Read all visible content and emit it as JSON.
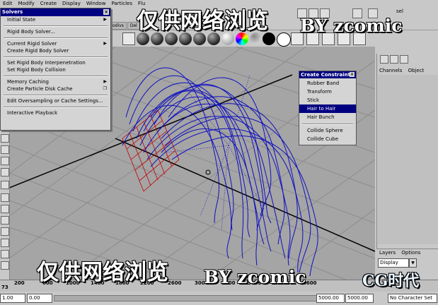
{
  "menubar": {
    "items": [
      "Edit",
      "Modify",
      "Create",
      "Display",
      "Window",
      "Particles",
      "Flu"
    ]
  },
  "toolbar": {
    "sel_label": "sel"
  },
  "shelf_tabs": [
    "odivs",
    "Del"
  ],
  "solvers_menu": {
    "title": "Solvers",
    "items": [
      {
        "label": "Initial State",
        "arrow": "▶"
      },
      {
        "label": "Rigid Body Solver..."
      },
      {
        "label": "Current Rigid Solver",
        "arrow": "▶"
      },
      {
        "label": "Create Rigid Body Solver"
      },
      {
        "label": "Set Rigid Body Interpenetration"
      },
      {
        "label": "Set Rigid Body Collision"
      },
      {
        "label": "Memory Caching",
        "arrow": "▶"
      },
      {
        "label": "Create Particle Disk Cache",
        "arrow": "❐"
      },
      {
        "label": "Edit Oversampling or Cache Settings..."
      },
      {
        "label": "Interactive Playback"
      }
    ]
  },
  "constraint_menu": {
    "title": "Create Constraint",
    "items": [
      "Rubber Band",
      "Transform",
      "Stick",
      "Hair to Hair",
      "Hair Bunch",
      "Collide Sphere",
      "Collide Cube"
    ],
    "selected": "Hair to Hair"
  },
  "channel_box": {
    "tabs": [
      "Channels",
      "Object"
    ]
  },
  "layers": {
    "tabs": [
      "Layers",
      "Options"
    ],
    "display": "Display"
  },
  "timeline": {
    "ticks": [
      "200",
      "600",
      "1000",
      "1400",
      "1800",
      "2200",
      "2600",
      "3000",
      "3400",
      "3800",
      "4200",
      "4600"
    ],
    "current_frame": "73"
  },
  "range": {
    "start": "1.00",
    "field2": "0.00",
    "end1": "5000.00",
    "end2": "5000.00",
    "character_set": "No Character Set"
  },
  "watermarks": {
    "top": "仅供网络浏览",
    "top_by": "BY zcomic",
    "bottom": "仅供网络浏览",
    "bottom_by": "BY zcomic",
    "logo": "CG时代"
  }
}
